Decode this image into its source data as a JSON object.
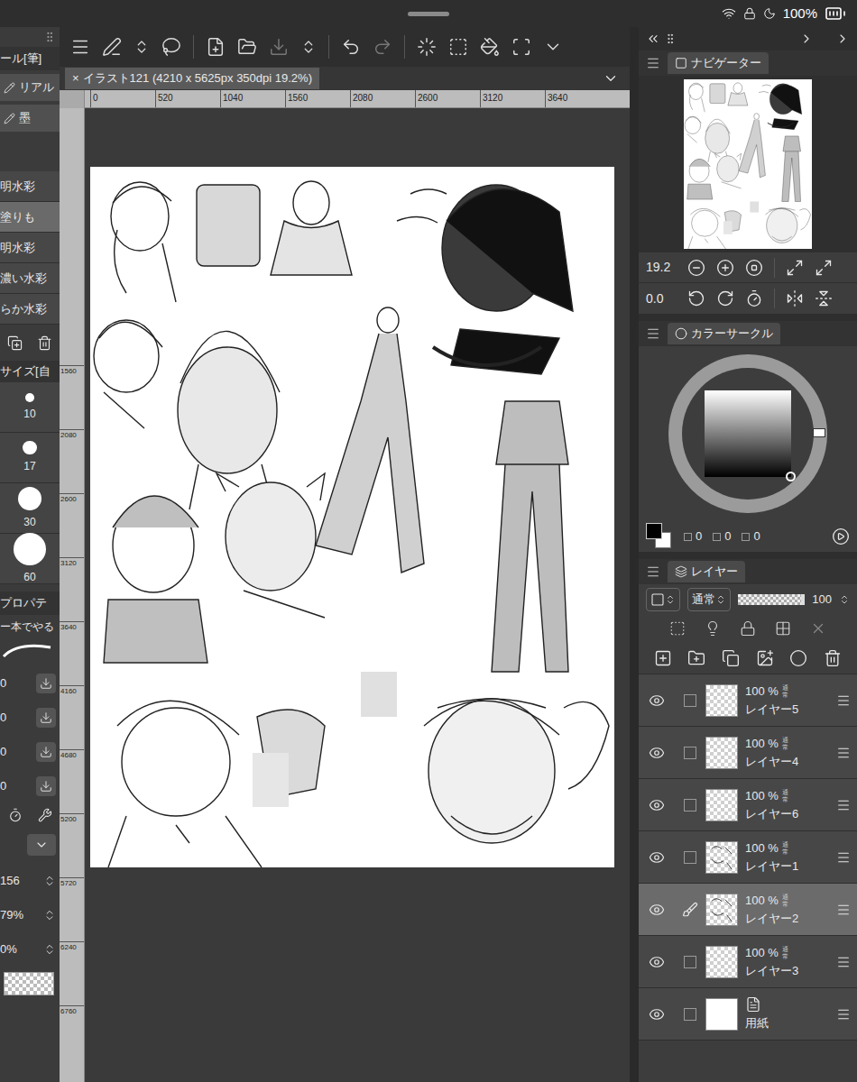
{
  "status_bar": {
    "battery": "100%"
  },
  "tool_panel": {
    "title": "ール[筆]",
    "groups": [
      {
        "label": "リアル",
        "selected": false
      },
      {
        "label": "墨",
        "selected": false
      }
    ],
    "brushes": [
      {
        "label": "明水彩",
        "selected": false
      },
      {
        "label": "塗りも",
        "selected": true
      },
      {
        "label": "明水彩",
        "selected": false
      },
      {
        "label": "濃い水彩",
        "selected": false
      },
      {
        "label": "らか水彩",
        "selected": false
      }
    ]
  },
  "brush_size": {
    "title": "サイズ[自",
    "sizes": [
      {
        "label": "10",
        "selected": false
      },
      {
        "label": "17",
        "selected": false
      },
      {
        "label": "30",
        "selected": false
      },
      {
        "label": "60",
        "selected": false
      }
    ]
  },
  "tool_property": {
    "title": "プロパテ",
    "preset": "ー本でやる",
    "rows": [
      "0",
      "0",
      "0",
      "0"
    ]
  },
  "sub_tool_values": [
    "156",
    "79%",
    "0%"
  ],
  "document_tab": {
    "close": "×",
    "title": "イラスト121 (4210 x 5625px 350dpi 19.2%)"
  },
  "rulers": {
    "horizontal": [
      "0",
      "520",
      "1040",
      "1560",
      "2080",
      "2600",
      "3120",
      "3640"
    ],
    "vertical": [
      "1560",
      "2080",
      "2600",
      "3120",
      "3640",
      "4160",
      "4680",
      "5200",
      "5720",
      "6240",
      "6760"
    ]
  },
  "navigator": {
    "title": "ナビゲーター",
    "zoom": "19.2",
    "rotation": "0.0"
  },
  "color_panel": {
    "title": "カラーサークル",
    "values": [
      "0",
      "0",
      "0"
    ]
  },
  "layer_panel": {
    "title": "レイヤー",
    "blend_mode": "通常",
    "opacity": "100",
    "layers": [
      {
        "name": "レイヤー5",
        "kind": "raster",
        "opacity": "100 %",
        "mode": "通常",
        "visible": true,
        "selected": false,
        "editing": false,
        "has_content": false
      },
      {
        "name": "レイヤー4",
        "kind": "raster",
        "opacity": "100 %",
        "mode": "通常",
        "visible": true,
        "selected": false,
        "editing": false,
        "has_content": false
      },
      {
        "name": "レイヤー6",
        "kind": "raster",
        "opacity": "100 %",
        "mode": "通常",
        "visible": true,
        "selected": false,
        "editing": false,
        "has_content": false
      },
      {
        "name": "レイヤー1",
        "kind": "raster",
        "opacity": "100 %",
        "mode": "通常",
        "visible": true,
        "selected": false,
        "editing": false,
        "has_content": true
      },
      {
        "name": "レイヤー2",
        "kind": "raster",
        "opacity": "100 %",
        "mode": "通常",
        "visible": true,
        "selected": true,
        "editing": true,
        "has_content": true
      },
      {
        "name": "レイヤー3",
        "kind": "raster",
        "opacity": "100 %",
        "mode": "通常",
        "visible": true,
        "selected": false,
        "editing": false,
        "has_content": false
      },
      {
        "name": "用紙",
        "kind": "paper",
        "opacity": "",
        "mode": "",
        "visible": true,
        "selected": false,
        "editing": false,
        "has_content": false
      }
    ]
  }
}
